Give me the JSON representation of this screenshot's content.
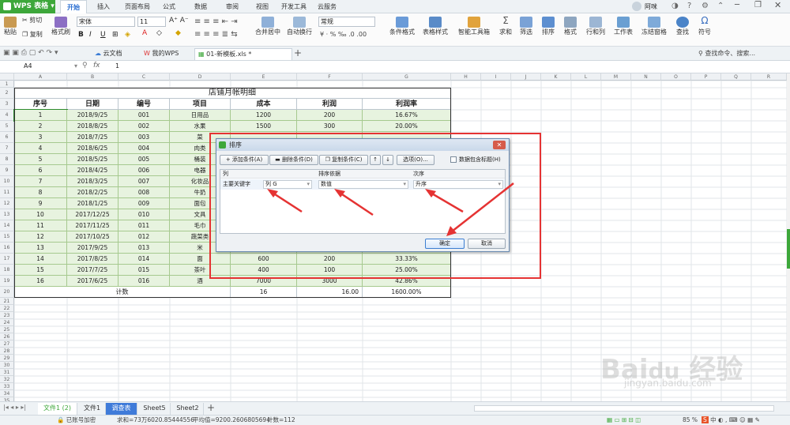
{
  "app": {
    "name": "WPS 表格",
    "user": "阿咪"
  },
  "menu": {
    "tabs": [
      "开始",
      "插入",
      "页面布局",
      "公式",
      "数据",
      "审阅",
      "视图",
      "开发工具",
      "云服务"
    ],
    "active": 0
  },
  "ribbon": {
    "paste": "粘贴",
    "cut": "剪切",
    "copy": "复制",
    "format_painter": "格式刷",
    "font_name": "宋体",
    "font_size": "11",
    "merge_center": "合并居中",
    "wrap_text": "自动换行",
    "number_format": "常规",
    "conditional_format": "条件格式",
    "table_style": "表格样式",
    "smart_toolbox": "智能工具箱",
    "sum": "求和",
    "filter": "筛选",
    "sort": "排序",
    "format": "格式",
    "rows_cols": "行和列",
    "worksheet": "工作表",
    "freeze": "冻结窗格",
    "find": "查找",
    "symbol": "符号"
  },
  "doc_tabs": [
    {
      "label": "云文档"
    },
    {
      "label": "我的WPS"
    },
    {
      "label": "01-新模板.xls *"
    }
  ],
  "search_hint": "查找命令、搜索...",
  "formula": {
    "name_box": "A4",
    "fx": "fx",
    "value": "1"
  },
  "columns": [
    "A",
    "B",
    "C",
    "D",
    "E",
    "F",
    "G",
    "H",
    "I",
    "J",
    "K",
    "L",
    "M",
    "N",
    "O",
    "P",
    "Q",
    "R"
  ],
  "sheet_title": "店铺月帐明细",
  "headers": [
    "序号",
    "日期",
    "编号",
    "项目",
    "成本",
    "利润",
    "利润率"
  ],
  "rows": [
    [
      "1",
      "2018/9/25",
      "001",
      "日用品",
      "1200",
      "200",
      "16.67%"
    ],
    [
      "2",
      "2018/8/25",
      "002",
      "水果",
      "1500",
      "300",
      "20.00%"
    ],
    [
      "3",
      "2018/7/25",
      "003",
      "菜",
      "",
      "",
      ""
    ],
    [
      "4",
      "2018/6/25",
      "004",
      "肉类",
      "",
      "",
      ""
    ],
    [
      "5",
      "2018/5/25",
      "005",
      "桶装",
      "",
      "",
      ""
    ],
    [
      "6",
      "2018/4/25",
      "006",
      "电器",
      "",
      "",
      ""
    ],
    [
      "7",
      "2018/3/25",
      "007",
      "化妆品",
      "",
      "",
      ""
    ],
    [
      "8",
      "2018/2/25",
      "008",
      "牛奶",
      "",
      "",
      ""
    ],
    [
      "9",
      "2018/1/25",
      "009",
      "面包",
      "",
      "",
      ""
    ],
    [
      "10",
      "2017/12/25",
      "010",
      "文具",
      "",
      "",
      ""
    ],
    [
      "11",
      "2017/11/25",
      "011",
      "毛巾",
      "",
      "",
      ""
    ],
    [
      "12",
      "2017/10/25",
      "012",
      "蔬菜类",
      "",
      "",
      ""
    ],
    [
      "13",
      "2017/9/25",
      "013",
      "米",
      "2200",
      "700",
      "31.82%"
    ],
    [
      "14",
      "2017/8/25",
      "014",
      "面",
      "600",
      "200",
      "33.33%"
    ],
    [
      "15",
      "2017/7/25",
      "015",
      "茶叶",
      "400",
      "100",
      "25.00%"
    ],
    [
      "16",
      "2017/6/25",
      "016",
      "酒",
      "7000",
      "3000",
      "42.86%"
    ]
  ],
  "totals": {
    "label": "计数",
    "cost": "16",
    "profit": "16.00",
    "rate": "1600.00%"
  },
  "dialog": {
    "title": "排序",
    "add": "添加条件(A)",
    "delete": "删除条件(D)",
    "copy": "复制条件(C)",
    "options": "选项(O)...",
    "has_header": "数据包含标题(H)",
    "col_header": "列",
    "basis_header": "排序依据",
    "order_header": "次序",
    "key_label": "主要关键字",
    "key_value": "列 G",
    "basis_value": "数值",
    "order_value": "升序",
    "ok": "确定",
    "cancel": "取消"
  },
  "sheets": [
    {
      "label": "文件1 (2)"
    },
    {
      "label": "文件1"
    },
    {
      "label": "调查表"
    },
    {
      "label": "Sheet5"
    },
    {
      "label": "Sheet2"
    }
  ],
  "status": {
    "encrypt": "已账号加密",
    "sum": "求和=73万6020.85444556",
    "avg": "平均值=9200.2606805694",
    "count": "计数=112",
    "zoom": "85 %"
  },
  "colors": {
    "accent": "#3da73a",
    "table_fill": "#e7f3df",
    "annotation": "#e53333"
  }
}
